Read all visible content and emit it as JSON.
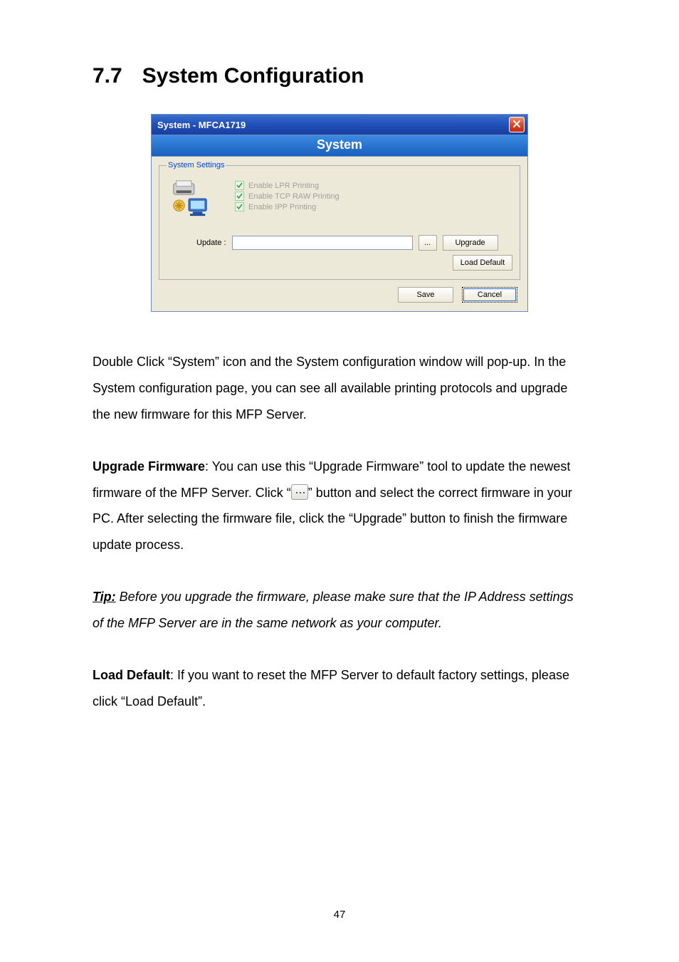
{
  "heading": {
    "number": "7.7",
    "title": "System Configuration"
  },
  "dialog": {
    "windowTitle": "System - MFCA1719",
    "banner": "System",
    "groupLegend": "System Settings",
    "checks": [
      {
        "label": "Enable LPR Printing"
      },
      {
        "label": "Enable TCP RAW Printing"
      },
      {
        "label": "Enable IPP Printing"
      }
    ],
    "updateLabel": "Update :",
    "updateValue": "",
    "browseButton": "...",
    "upgradeButton": "Upgrade",
    "loadDefaultButton": "Load Default",
    "saveButton": "Save",
    "cancelButton": "Cancel"
  },
  "paragraphs": {
    "intro": "Double Click “System” icon and the System configuration window will pop-up. In the System configuration page, you can see all available printing protocols and upgrade the new firmware for this MFP Server.",
    "upgradeStrong": "Upgrade Firmware",
    "upgradePart1": ": You can use this “Upgrade Firmware” tool to update the newest firmware of the MFP Server. Click “",
    "upgradePart2": "” button and select the correct firmware in your PC. After selecting the firmware file, click the “Upgrade” button to finish the firmware update process.",
    "tipLabel": "Tip:",
    "tipText": " Before you upgrade the firmware, please make sure that the IP Address settings of the MFP Server are in the same network as your computer.",
    "loadDefaultStrong": "Load Default",
    "loadDefaultText": ": If you want to reset the MFP Server to default factory settings, please click “Load Default”."
  },
  "pageNumber": "47"
}
